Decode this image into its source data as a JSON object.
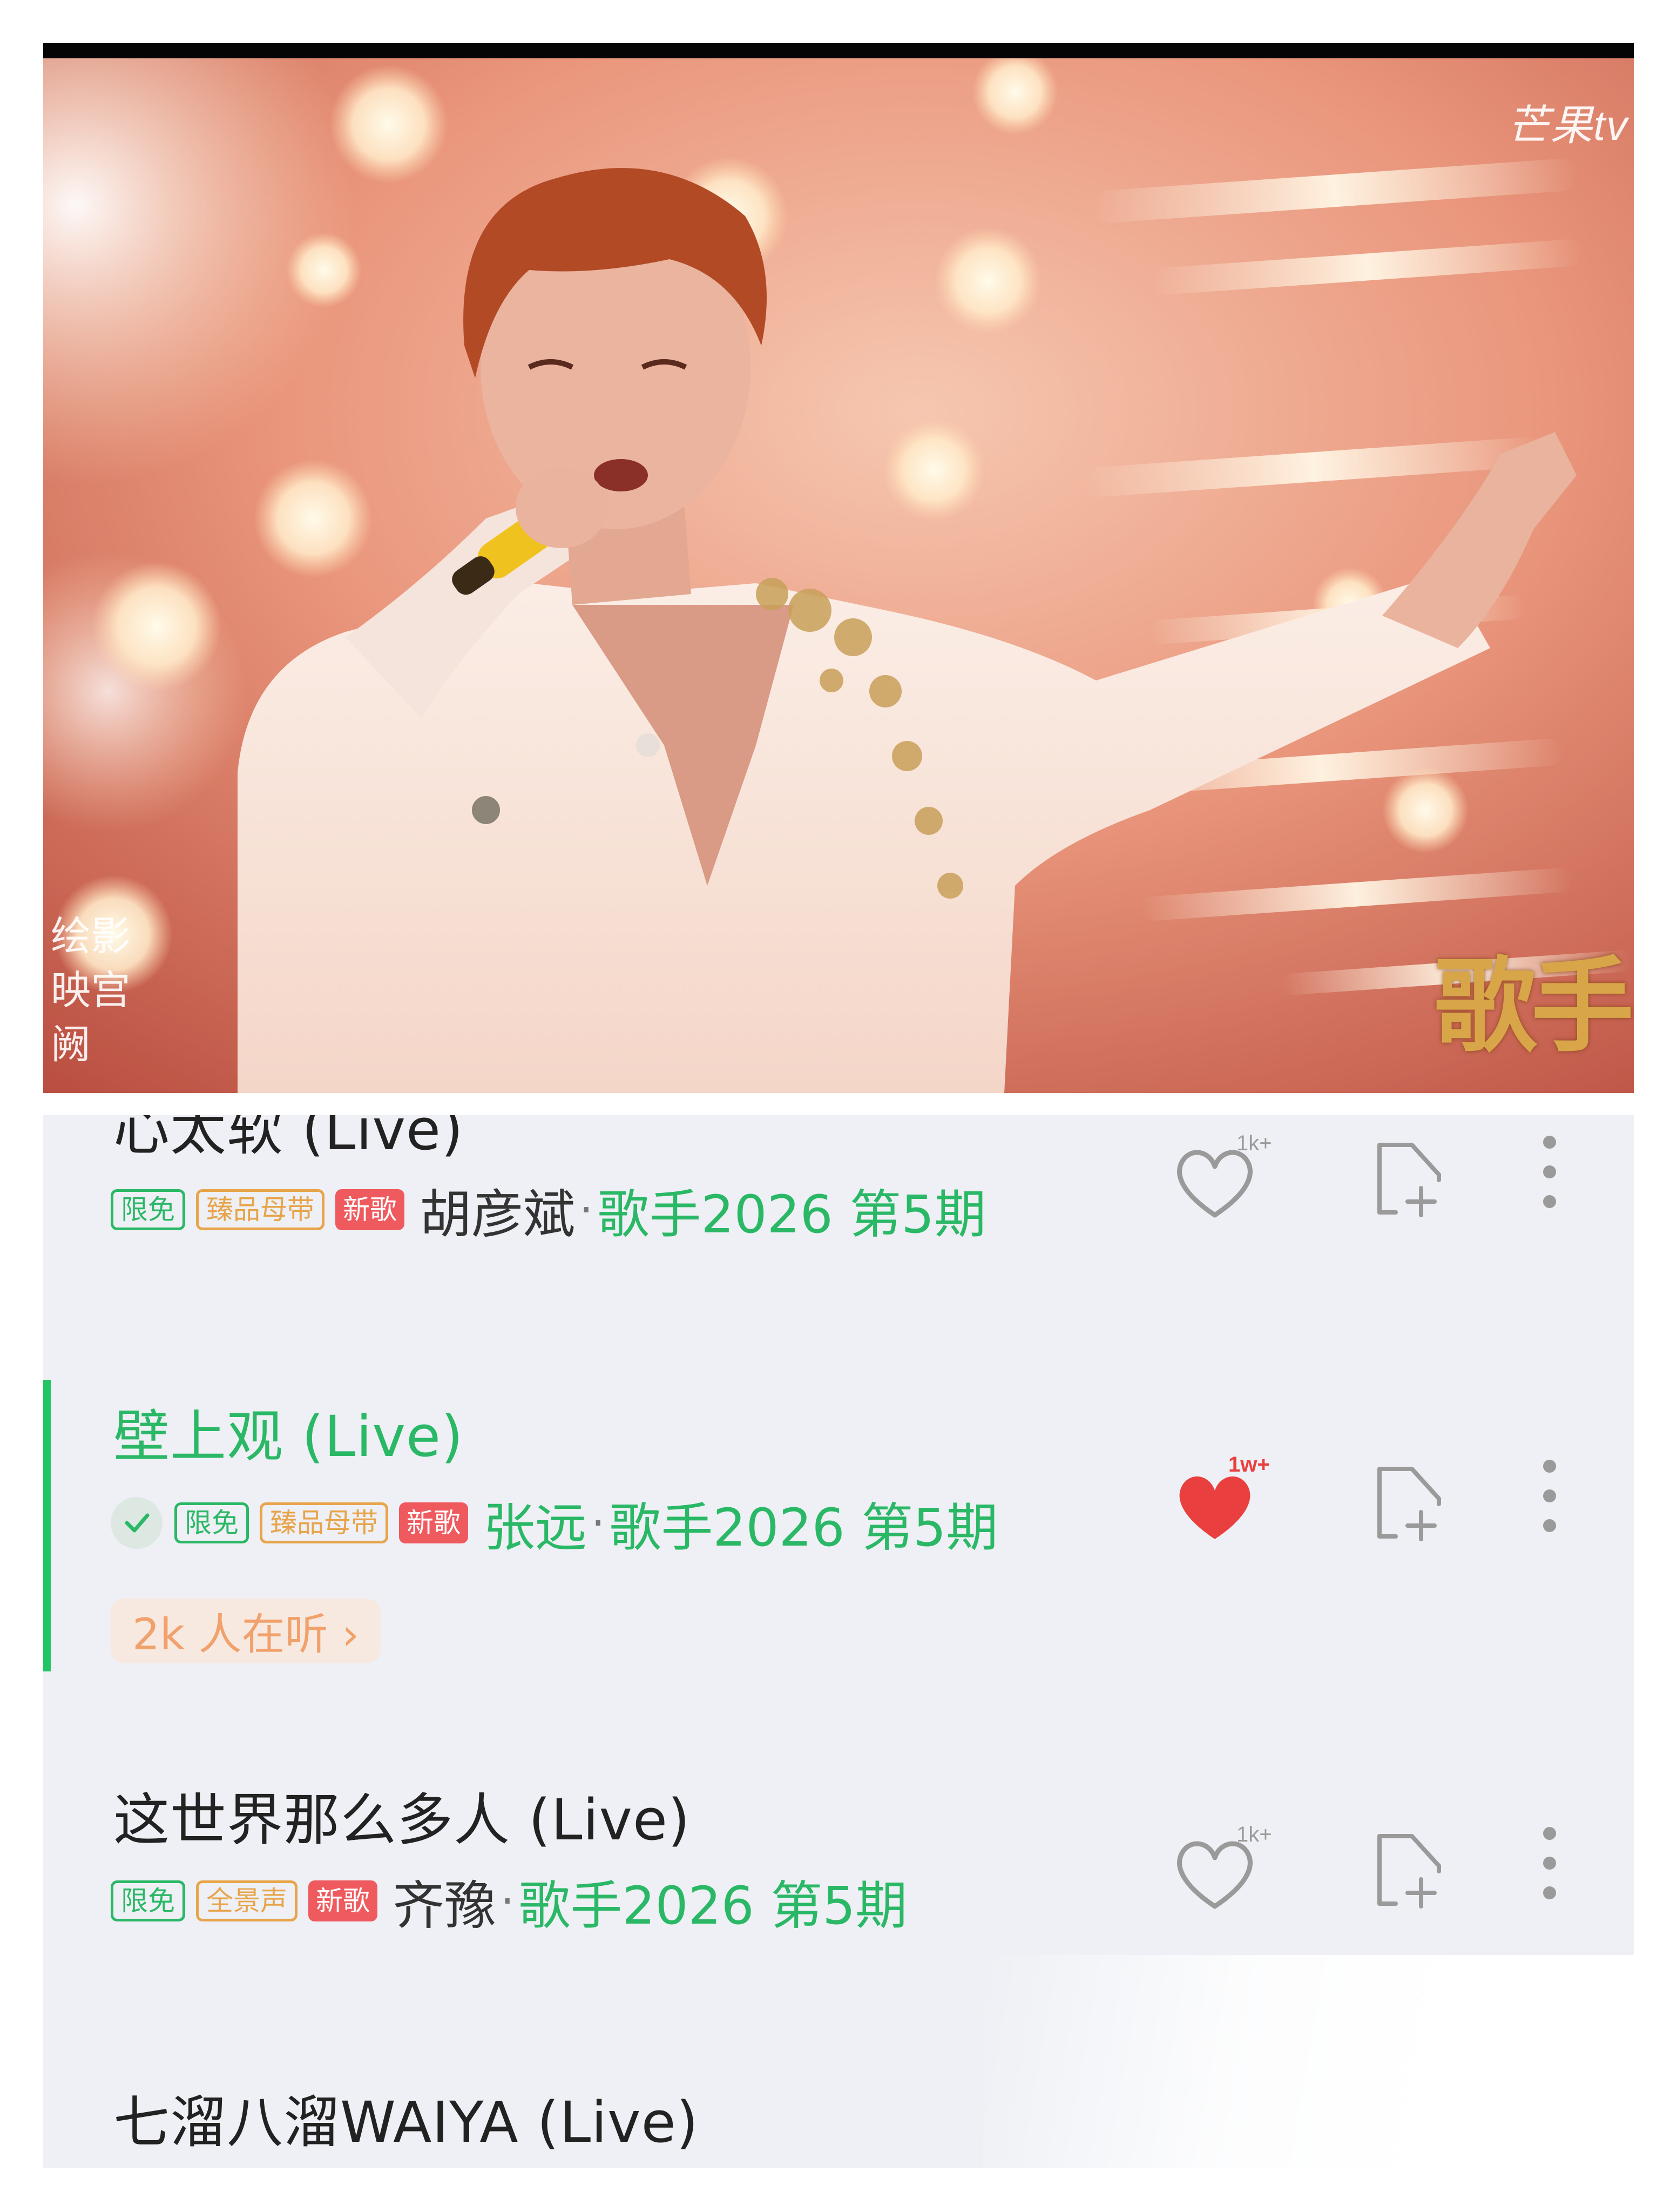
{
  "video": {
    "channel_watermark": "芒果tv",
    "left_watermark": "绘影\n映宫阙",
    "show_logo": "歌手"
  },
  "songs": [
    {
      "title": "心太软 (Live)",
      "tags": [
        "限免",
        "臻品母带",
        "新歌"
      ],
      "artist": "胡彦斌",
      "album": "歌手2026 第5期",
      "like_count": "1k+",
      "liked": false,
      "active": false
    },
    {
      "title": "壁上观 (Live)",
      "tags": [
        "限免",
        "臻品母带",
        "新歌"
      ],
      "artist": "张远",
      "album": "歌手2026 第5期",
      "like_count": "1w+",
      "liked": true,
      "active": true,
      "listening": "2k 人在听 ›"
    },
    {
      "title": "这世界那么多人 (Live)",
      "tags": [
        "限免",
        "全景声",
        "新歌"
      ],
      "artist": "齐豫",
      "album": "歌手2026 第5期",
      "like_count": "1k+",
      "liked": false,
      "active": false
    },
    {
      "title": "七溜八溜WAIYA (Live)",
      "active": false
    }
  ],
  "separator": "·",
  "colors": {
    "accent_green": "#2bb866",
    "like_red": "#e9403f",
    "tag_gold": "#e7a44a",
    "new_tag_red": "#ef5a5e",
    "list_background": "#eef0f5"
  },
  "icons": {
    "like": "heart-icon",
    "add_to_playlist": "add-to-playlist-icon",
    "more": "more-vertical-icon",
    "playing": "check-icon"
  }
}
